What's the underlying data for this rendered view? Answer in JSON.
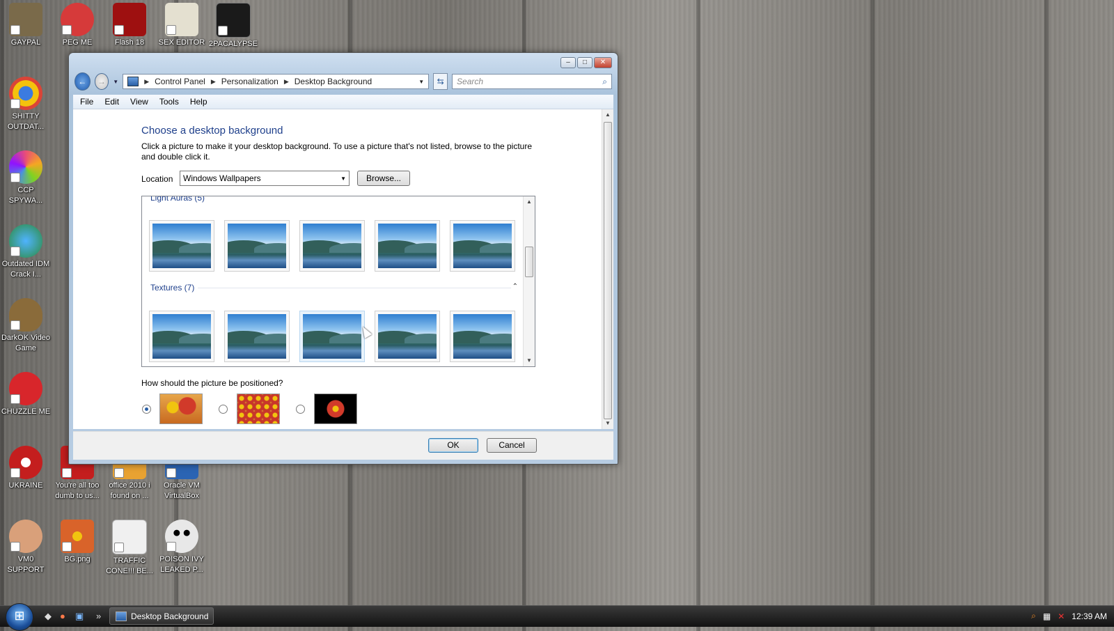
{
  "desktop": {
    "icons": [
      {
        "label": "GAYPAL",
        "color": "#7a6a4a"
      },
      {
        "label": "PEG ME",
        "color": "#d63a3a"
      },
      {
        "label": "Flash 18",
        "color": "#9e1010"
      },
      {
        "label": "SEX EDITOR",
        "color": "#e4e0d0"
      },
      {
        "label": "2PACALYPSE",
        "color": "#1a1a1a"
      },
      {
        "label": "SHITTY OUTDAT...",
        "color": "#3b7be0"
      },
      {
        "label": "CCP SPYWA...",
        "color": "#e94e77"
      },
      {
        "label": "Outdated IDM Crack I...",
        "color": "#2c8a3a"
      },
      {
        "label": "DarkOK Video Game",
        "color": "#8a6b3a"
      },
      {
        "label": "CHUZZLE ME",
        "color": "#d8262b"
      },
      {
        "label": "UKRAINE",
        "color": "#c41e1e"
      },
      {
        "label": "You're all too dumb to us...",
        "color": "#c41e1e"
      },
      {
        "label": "office 2010 i found on ...",
        "color": "#e8a232"
      },
      {
        "label": "Oracle VM VirtualBox",
        "color": "#2b64b3"
      },
      {
        "label": "VM0 SUPPORT",
        "color": "#d9a07a"
      },
      {
        "label": "BG.png",
        "color": "#d9632a"
      },
      {
        "label": "TRAFFIC CONE!!! BE...",
        "color": "#f0f0f0"
      },
      {
        "label": "POISON IVY LEAKED P...",
        "color": "#e8e8e8"
      }
    ]
  },
  "window": {
    "breadcrumb": [
      "Control Panel",
      "Personalization",
      "Desktop Background"
    ],
    "search_placeholder": "Search",
    "menu": [
      "File",
      "Edit",
      "View",
      "Tools",
      "Help"
    ],
    "heading": "Choose a desktop background",
    "description": "Click a picture to make it your desktop background. To use a picture that's not listed, browse to the picture and double click it.",
    "location_label": "Location",
    "location_value": "Windows Wallpapers",
    "browse_label": "Browse...",
    "groups": [
      {
        "name": "Light Auras (5)",
        "count": 5
      },
      {
        "name": "Textures (7)",
        "count": 5
      }
    ],
    "position_question": "How should the picture be positioned?",
    "position_options": [
      "fill",
      "tile",
      "center"
    ],
    "selected_position": "fill",
    "ok_label": "OK",
    "cancel_label": "Cancel"
  },
  "taskbar": {
    "task_label": "Desktop Background",
    "clock": "12:39 AM"
  }
}
